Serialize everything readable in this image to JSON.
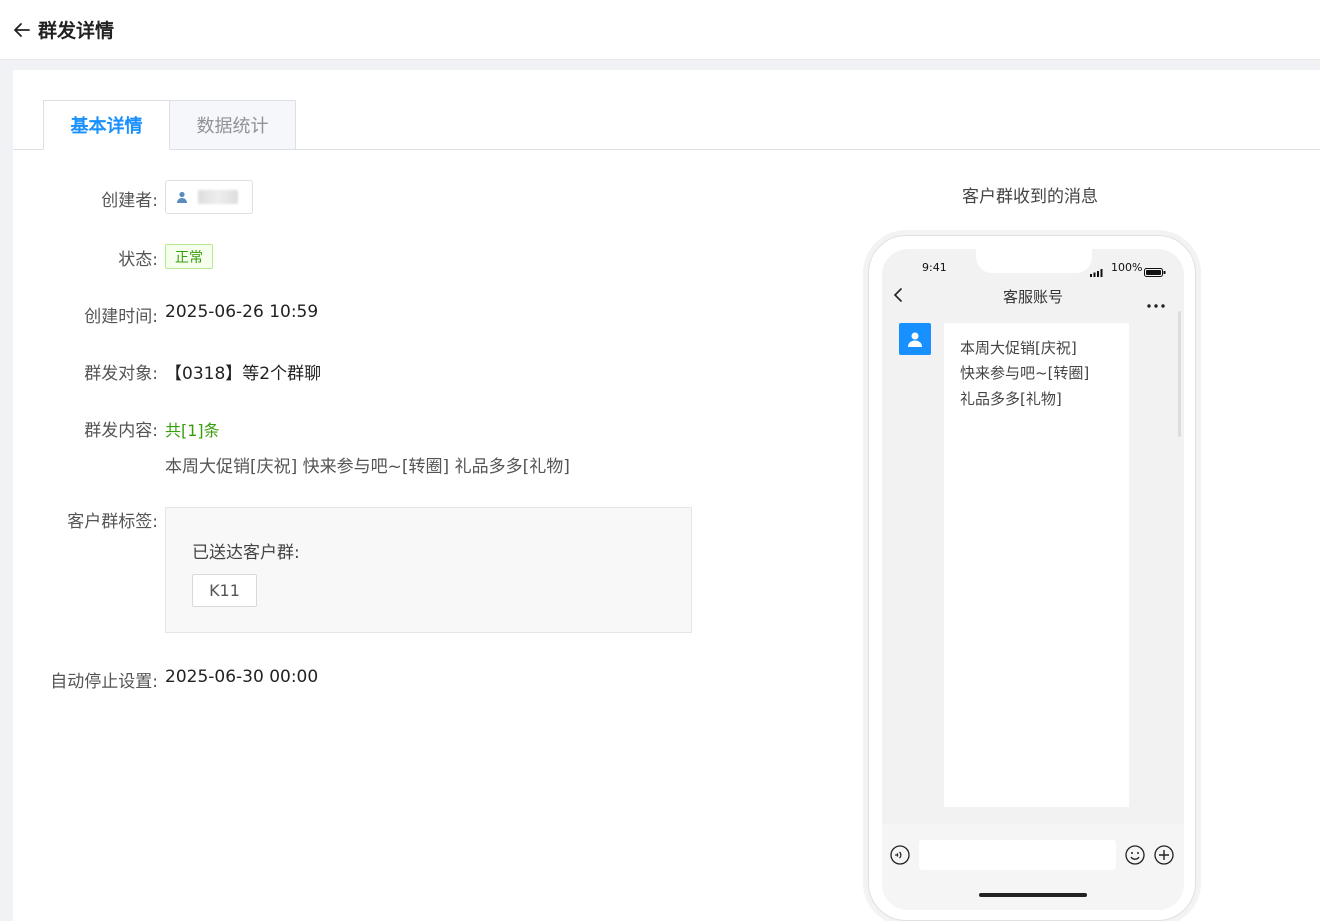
{
  "header": {
    "title": "群发详情"
  },
  "tabs": [
    {
      "label": "基本详情"
    },
    {
      "label": "数据统计"
    }
  ],
  "details": {
    "creator_label": "创建者:",
    "status_label": "状态:",
    "status_value": "正常",
    "created_time_label": "创建时间:",
    "created_time_value": "2025-06-26 10:59",
    "target_label": "群发对象:",
    "target_value": "【0318】等2个群聊",
    "content_label": "群发内容:",
    "content_count": "共[1]条",
    "content_text": "本周大促销[庆祝] 快来参与吧~[转圈] 礼品多多[礼物]",
    "tags_label": "客户群标签:",
    "tags_title": "已送达客户群:",
    "tags": [
      "K11"
    ],
    "auto_stop_label": "自动停止设置:",
    "auto_stop_value": "2025-06-30 00:00"
  },
  "preview": {
    "title": "客户群收到的消息",
    "status_time": "9:41",
    "battery": "100%",
    "chat_title": "客服账号",
    "message_lines": [
      "本周大促销[庆祝]",
      "快来参与吧~[转圈]",
      "礼品多多[礼物]"
    ]
  },
  "icons": {
    "back": "arrow-left-icon",
    "user": "user-icon",
    "more": "more-icon",
    "voice": "voice-icon",
    "emoji": "emoji-icon",
    "plus": "plus-icon"
  },
  "colors": {
    "accent": "#1890ff",
    "success": "#389e0d"
  }
}
